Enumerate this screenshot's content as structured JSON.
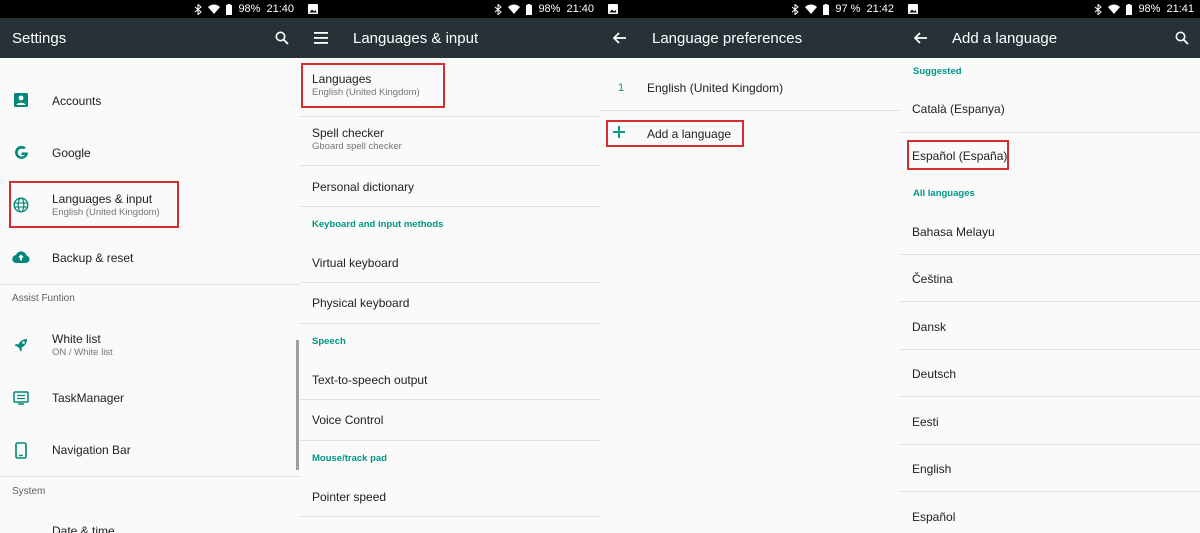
{
  "status": {
    "panel1": {
      "battery": "98%",
      "time": "21:40"
    },
    "panel2": {
      "battery": "98%",
      "time": "21:40"
    },
    "panel3": {
      "battery": "97 %",
      "time": "21:42"
    },
    "panel4": {
      "battery": "98%",
      "time": "21:41"
    }
  },
  "settings": {
    "title": "Settings",
    "items": [
      {
        "label": "Accounts",
        "icon": "account-box-icon"
      },
      {
        "label": "Google",
        "icon": "google-g-icon"
      },
      {
        "label": "Languages & input",
        "sub": "English (United Kingdom)",
        "icon": "globe-icon"
      },
      {
        "label": "Backup & reset",
        "icon": "cloud-upload-icon"
      }
    ],
    "section_assist": "Assist Funtion",
    "assist_items": [
      {
        "label": "White list",
        "sub": "ON / White list",
        "icon": "rocket-icon"
      },
      {
        "label": "TaskManager",
        "icon": "taskmanager-icon"
      },
      {
        "label": "Navigation Bar",
        "icon": "phone-icon"
      }
    ],
    "section_system": "System",
    "system_items": [
      {
        "label": "Date & time"
      }
    ]
  },
  "languages_input": {
    "title": "Languages & input",
    "items": [
      {
        "label": "Languages",
        "sub": "English (United Kingdom)"
      },
      {
        "label": "Spell checker",
        "sub": "Gboard spell checker"
      },
      {
        "label": "Personal dictionary"
      }
    ],
    "section_keyboard": "Keyboard and input methods",
    "keyboard_items": [
      {
        "label": "Virtual keyboard"
      },
      {
        "label": "Physical keyboard"
      }
    ],
    "section_speech": "Speech",
    "speech_items": [
      {
        "label": "Text-to-speech output"
      },
      {
        "label": "Voice Control"
      }
    ],
    "section_mouse": "Mouse/track pad",
    "mouse_items": [
      {
        "label": "Pointer speed"
      }
    ]
  },
  "language_prefs": {
    "title": "Language preferences",
    "languages": [
      {
        "index": "1",
        "label": "English (United Kingdom)"
      }
    ],
    "add_label": "Add a language"
  },
  "add_language": {
    "title": "Add a language",
    "section_suggested": "Suggested",
    "suggested": [
      "Català (Espanya)",
      "Español (España)"
    ],
    "section_all": "All languages",
    "all": [
      "Bahasa Melayu",
      "Čeština",
      "Dansk",
      "Deutsch",
      "Eesti",
      "English",
      "Español"
    ]
  },
  "colors": {
    "toolbar": "#263238",
    "accent": "#009688",
    "highlight": "#d32f2f"
  }
}
